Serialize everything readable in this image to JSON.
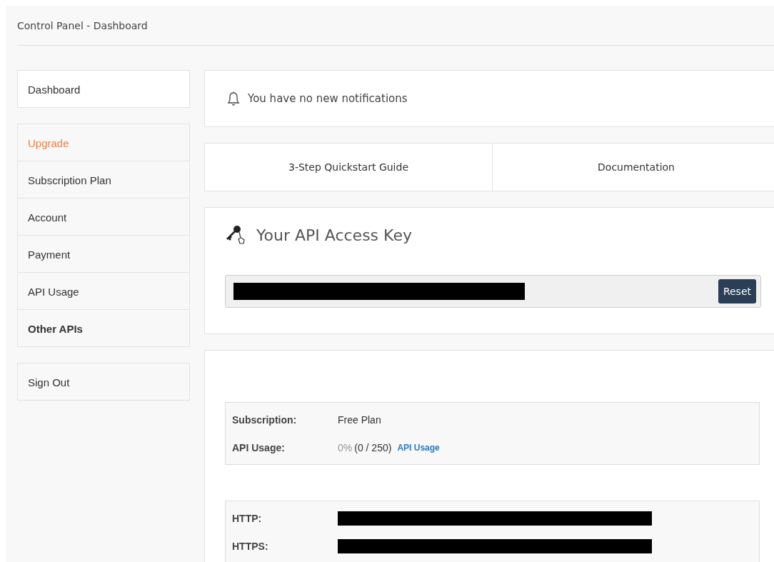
{
  "header": {
    "title": "Control Panel - Dashboard"
  },
  "sidebar": {
    "groups": [
      [
        {
          "label": "Dashboard",
          "kind": "home"
        }
      ],
      [
        {
          "label": "Upgrade",
          "kind": "upgrade"
        },
        {
          "label": "Subscription Plan",
          "kind": "normal"
        },
        {
          "label": "Account",
          "kind": "normal"
        },
        {
          "label": "Payment",
          "kind": "normal"
        },
        {
          "label": "API Usage",
          "kind": "normal"
        },
        {
          "label": "Other APIs",
          "kind": "strong"
        }
      ],
      [
        {
          "label": "Sign Out",
          "kind": "normal"
        }
      ]
    ]
  },
  "notification": {
    "text": "You have no new notifications"
  },
  "links": [
    "3-Step Quickstart Guide",
    "Documentation"
  ],
  "api_key": {
    "title": "Your API Access Key",
    "button": "Reset"
  },
  "subscription": {
    "rows": [
      {
        "label": "Subscription:",
        "value": "Free Plan"
      },
      {
        "label": "API Usage:",
        "percent": "0%",
        "value": "(0 / 250)",
        "link": "API Usage"
      }
    ]
  },
  "endpoints": {
    "rows": [
      {
        "label": "HTTP:"
      },
      {
        "label": "HTTPS:"
      }
    ]
  }
}
